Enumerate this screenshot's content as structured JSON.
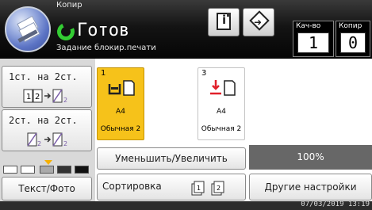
{
  "header": {
    "app_name": "Копир",
    "status": "Готов",
    "substatus": "Задание блокир.печати"
  },
  "counters": {
    "quantity_label": "Кач-во",
    "quantity_value": "1",
    "copies_label": "Копир",
    "copies_value": "0"
  },
  "duplex": {
    "option1": "1ст. на 2ст.",
    "option2": "2ст. на 2ст."
  },
  "trays": [
    {
      "number": "1",
      "paper_size": "A4",
      "paper_type": "Обычная 2",
      "selected": true,
      "color": "#f6c21a"
    },
    {
      "number": "3",
      "paper_size": "A4",
      "paper_type": "Обычная 2",
      "selected": false,
      "color": "#ffffff"
    }
  ],
  "zoom": {
    "label": "Уменьшить/Увеличить",
    "value": "100%"
  },
  "density": {
    "level": 3,
    "levels": 5
  },
  "original_type": "Текст/Фото",
  "sort_label": "Сортировка",
  "more_settings": "Другие настройки",
  "datetime": "07/03/2019 13:19",
  "icons": [
    "copier-icon",
    "ready-status-icon",
    "info-icon",
    "login-icon",
    "duplex-icon",
    "tray-icon",
    "sort-icon"
  ]
}
